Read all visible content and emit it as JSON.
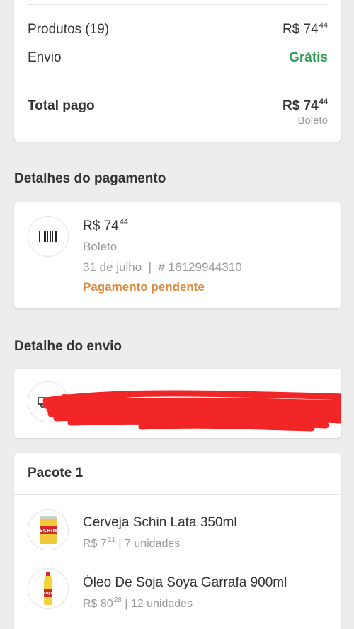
{
  "summary": {
    "products_label": "Produtos (19)",
    "products_price_int": "R$ 74",
    "products_price_cents": "44",
    "shipping_label": "Envio",
    "shipping_value": "Grátis",
    "total_label": "Total pago",
    "total_price_int": "R$ 74",
    "total_price_cents": "44",
    "total_method": "Boleto"
  },
  "payment": {
    "section_title": "Detalhes do pagamento",
    "amount_int": "R$ 74",
    "amount_cents": "44",
    "method": "Boleto",
    "date_and_id": "31 de julho  |  # 16129944310",
    "status": "Pagamento pendente",
    "icon": "barcode-icon"
  },
  "shipping": {
    "section_title": "Detalhe do envio",
    "icon": "truck-icon"
  },
  "package": {
    "title": "Pacote 1",
    "items": [
      {
        "name": "Cerveja Schin Lata 350ml",
        "price_int": "R$ 7",
        "price_cents": "21",
        "qty": " | 7 unidades",
        "image_text": "SCHIN"
      },
      {
        "name": "Óleo De Soja Soya Garrafa 900ml",
        "price_int": "R$ 80",
        "price_cents": "28",
        "qty": " | 12 unidades",
        "image_text": "Soya"
      }
    ]
  },
  "colors": {
    "green": "#2e9d56",
    "orange": "#e08a3c",
    "redaction": "#f22626",
    "background": "#ededed"
  }
}
